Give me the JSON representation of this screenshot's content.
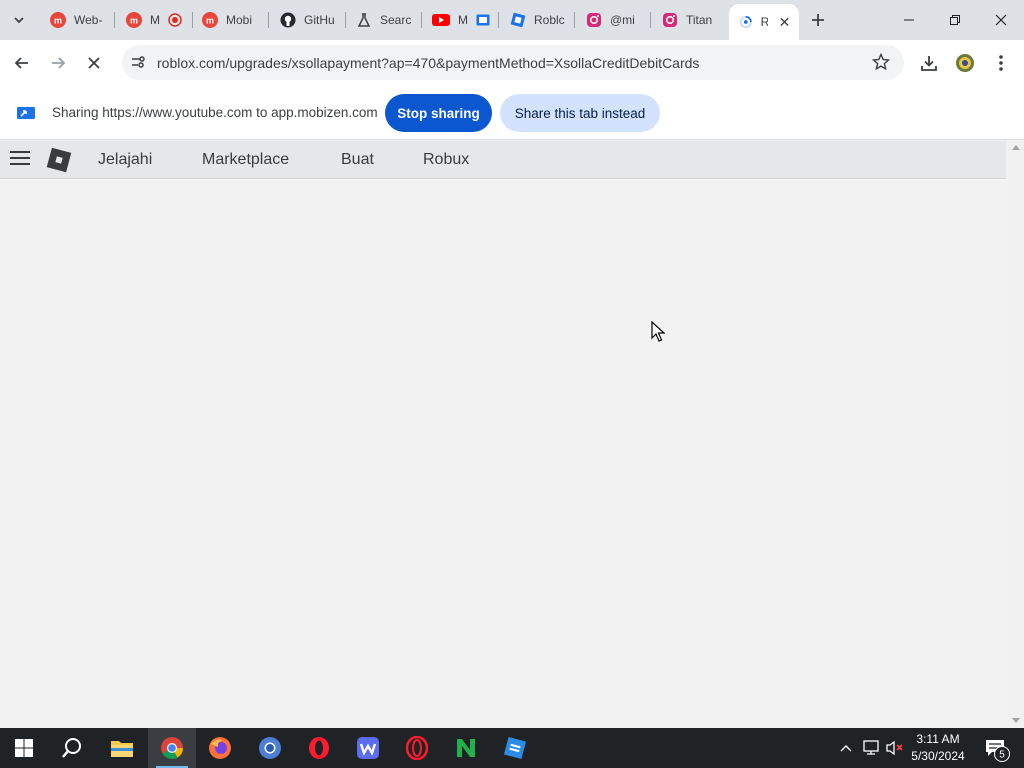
{
  "browser": {
    "tabs": [
      {
        "label": "Web-",
        "icon": "mobizen-icon"
      },
      {
        "label": "M",
        "icon": "mobizen-icon"
      },
      {
        "label": "Mobi",
        "icon": "mobizen-icon"
      },
      {
        "label": "GitHu",
        "icon": "github-icon"
      },
      {
        "label": "Searc",
        "icon": "flask-icon"
      },
      {
        "label": "M",
        "icon": "youtube-icon"
      },
      {
        "label": "Roblc",
        "icon": "roblox-studio-icon"
      },
      {
        "label": "@mi",
        "icon": "instagram-icon"
      },
      {
        "label": "Titan",
        "icon": "instagram-icon"
      },
      {
        "label": "R",
        "icon": "loading-icon"
      }
    ],
    "new_tab_label": "+",
    "close_tab_label": "✕",
    "url": "roblox.com/upgrades/xsollapayment?ap=470&paymentMethod=XsollaCreditDebitCards"
  },
  "sharing_bar": {
    "text": "Sharing https://www.youtube.com to app.mobizen.com",
    "stop_label": "Stop sharing",
    "share_tab_label": "Share this tab instead"
  },
  "roblox_nav": {
    "links": [
      "Jelajahi",
      "Marketplace",
      "Buat",
      "Robux"
    ]
  },
  "taskbar": {
    "time": "3:11 AM",
    "date": "5/30/2024",
    "notification_count": "5"
  },
  "colors": {
    "accent": "#0b57d0",
    "share_secondary": "#d3e3fd",
    "page_bg": "#f2f2f3",
    "taskbar": "#1f2326"
  }
}
